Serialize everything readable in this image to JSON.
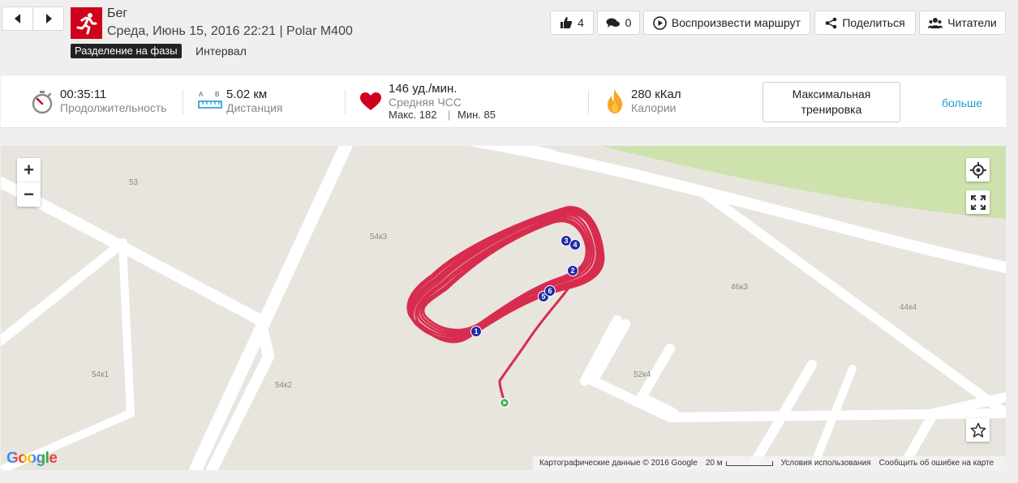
{
  "header": {
    "sport": "Бег",
    "session_meta": "Среда, Июнь 15, 2016 22:21 | Polar M400",
    "phase_badge": "Разделение на фазы",
    "phase_value": "Интервал",
    "likes": "4",
    "comments": "0",
    "replay_label": "Воспроизвести маршрут",
    "share_label": "Поделиться",
    "followers_label": "Читатели"
  },
  "summary": {
    "duration": {
      "value": "00:35:11",
      "label": "Продолжительность"
    },
    "distance": {
      "value": "5.02 км",
      "label": "Дистанция",
      "icon_a": "A",
      "icon_b": "B"
    },
    "heart_rate": {
      "value": "146 уд./мин.",
      "label": "Средняя ЧСС",
      "max_label": "Макс. 182",
      "sep": "|",
      "min_label": "Мин. 85"
    },
    "calories": {
      "value": "280 кКал",
      "label": "Калории"
    },
    "training_button": "Максимальная тренировка",
    "more_link": "больше"
  },
  "map": {
    "buildings": [
      "53",
      "54к3",
      "54к1",
      "54к2",
      "52к4",
      "46к3",
      "44к4"
    ],
    "lap_markers": [
      "1",
      "2",
      "3",
      "4",
      "5",
      "6"
    ],
    "google_logo": "Google",
    "attribution": "Картографические данные © 2016 Google",
    "scale_label": "20 м",
    "terms": "Условия использования",
    "report": "Сообщить об ошибке на карте",
    "zoom_in": "+",
    "zoom_out": "−"
  },
  "colors": {
    "brand_red": "#d0021b",
    "route": "#d7193f",
    "lap_marker": "#1f2aa8",
    "start_marker": "#3cb44b",
    "link": "#1a9bd7"
  },
  "icons": [
    "chevron-left-icon",
    "chevron-right-icon",
    "running-icon",
    "thumbs-up-icon",
    "comment-icon",
    "play-circle-icon",
    "share-icon",
    "followers-icon",
    "stopwatch-icon",
    "ruler-icon",
    "heart-icon",
    "flame-icon",
    "locate-icon",
    "fullscreen-icon",
    "star-icon"
  ]
}
